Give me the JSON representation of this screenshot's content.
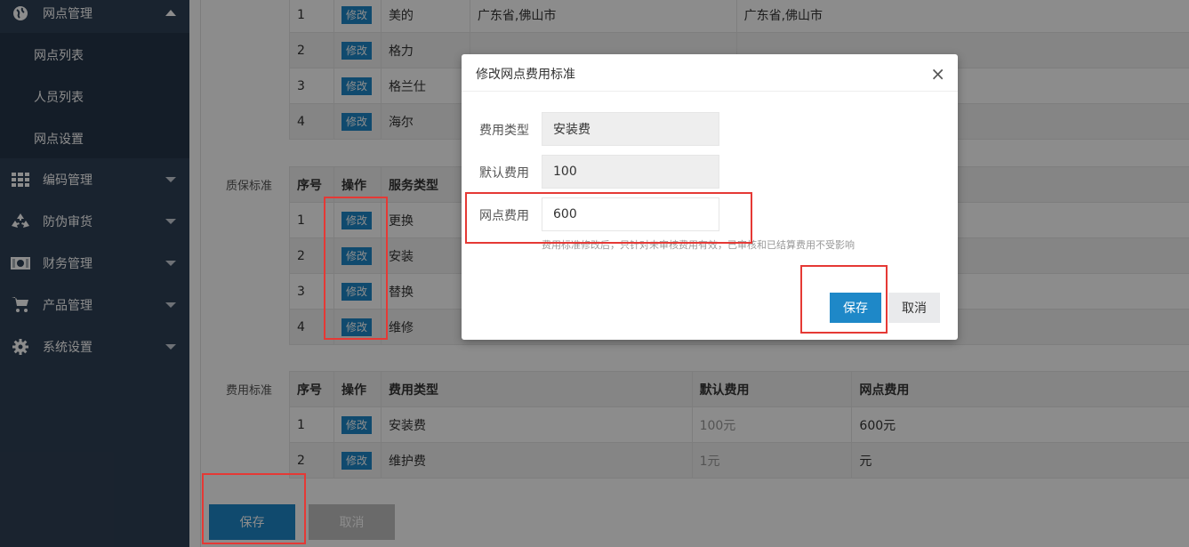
{
  "sidebar": {
    "groups": [
      {
        "label": "网点管理",
        "icon": "globe-icon"
      },
      {
        "label": "编码管理",
        "icon": "grid-icon"
      },
      {
        "label": "防伪审货",
        "icon": "recycle-icon"
      },
      {
        "label": "财务管理",
        "icon": "money-icon"
      },
      {
        "label": "产品管理",
        "icon": "cart-icon"
      },
      {
        "label": "系统设置",
        "icon": "gear-icon"
      }
    ],
    "sub_items": [
      "网点列表",
      "人员列表",
      "网点设置"
    ]
  },
  "brand_table": {
    "edit_label": "修改",
    "rows": [
      {
        "no": "1",
        "brand": "美的",
        "region1": "广东省,佛山市",
        "region2": "广东省,佛山市"
      },
      {
        "no": "2",
        "brand": "格力",
        "region1": "",
        "region2": ""
      },
      {
        "no": "3",
        "brand": "格兰仕",
        "region1": "",
        "region2": ""
      },
      {
        "no": "4",
        "brand": "海尔",
        "region1": "",
        "region2": ""
      }
    ]
  },
  "warranty": {
    "label": "质保标准",
    "headers": [
      "序号",
      "操作",
      "服务类型"
    ],
    "edit_label": "修改",
    "rows": [
      {
        "no": "1",
        "type": "更换"
      },
      {
        "no": "2",
        "type": "安装"
      },
      {
        "no": "3",
        "type": "替换"
      },
      {
        "no": "4",
        "type": "维修"
      }
    ]
  },
  "fee": {
    "label": "费用标准",
    "headers": [
      "序号",
      "操作",
      "费用类型",
      "默认费用",
      "网点费用"
    ],
    "edit_label": "修改",
    "rows": [
      {
        "no": "1",
        "type": "安装费",
        "default": "100元",
        "outlet": "600元"
      },
      {
        "no": "2",
        "type": "维护费",
        "default": "1元",
        "outlet": "元"
      }
    ]
  },
  "page_buttons": {
    "save": "保存",
    "cancel": "取消"
  },
  "modal": {
    "title": "修改网点费用标准",
    "close": "×",
    "fields": [
      {
        "label": "费用类型",
        "value": "安装费"
      },
      {
        "label": "默认费用",
        "value": "100"
      },
      {
        "label": "网点费用",
        "value": "600"
      }
    ],
    "hint": "费用标准修改后，只针对未审核费用有效，已审核和已结算费用不受影响",
    "save": "保存",
    "cancel": "取消"
  },
  "colors": {
    "sidebar": "#2f4056",
    "primary": "#1e88c8",
    "highlight": "#e53935"
  }
}
